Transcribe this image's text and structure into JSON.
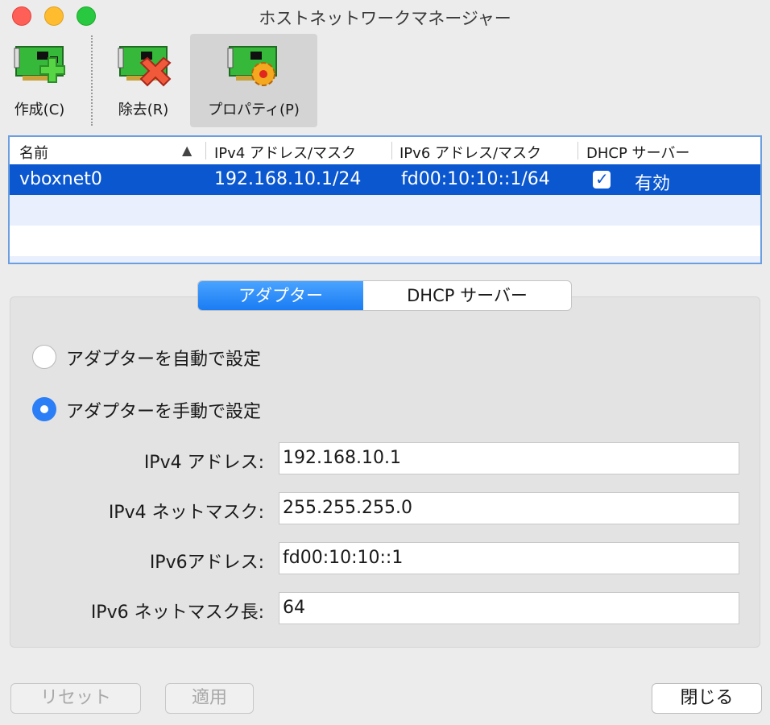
{
  "window": {
    "title": "ホストネットワークマネージャー"
  },
  "toolbar": {
    "create_label": "作成(C)",
    "remove_label": "除去(R)",
    "properties_label": "プロパティ(P)"
  },
  "table": {
    "columns": [
      "名前",
      "IPv4 アドレス/マスク",
      "IPv6 アドレス/マスク",
      "DHCP サーバー"
    ],
    "rows": [
      {
        "name": "vboxnet0",
        "ipv4": "192.168.10.1/24",
        "ipv6": "fd00:10:10::1/64",
        "dhcp_checked": true,
        "dhcp": "有効"
      }
    ]
  },
  "tabs": {
    "adapter": "アダプター",
    "dhcp": "DHCP サーバー",
    "selected": "アダプター"
  },
  "adapter": {
    "auto_label": "アダプターを自動で設定",
    "manual_label": "アダプターを手動で設定",
    "mode": "manual",
    "ipv4_address_label": "IPv4 アドレス:",
    "ipv4_address": "192.168.10.1",
    "ipv4_mask_label": "IPv4 ネットマスク:",
    "ipv4_mask": "255.255.255.0",
    "ipv6_address_label": "IPv6アドレス:",
    "ipv6_address": "fd00:10:10::1",
    "ipv6_prefix_label": "IPv6 ネットマスク長:",
    "ipv6_prefix": "64"
  },
  "buttons": {
    "reset": "リセット",
    "apply": "適用",
    "close": "閉じる"
  },
  "colors": {
    "selection": "#0a57d0",
    "accent": "#2b7ef6"
  }
}
